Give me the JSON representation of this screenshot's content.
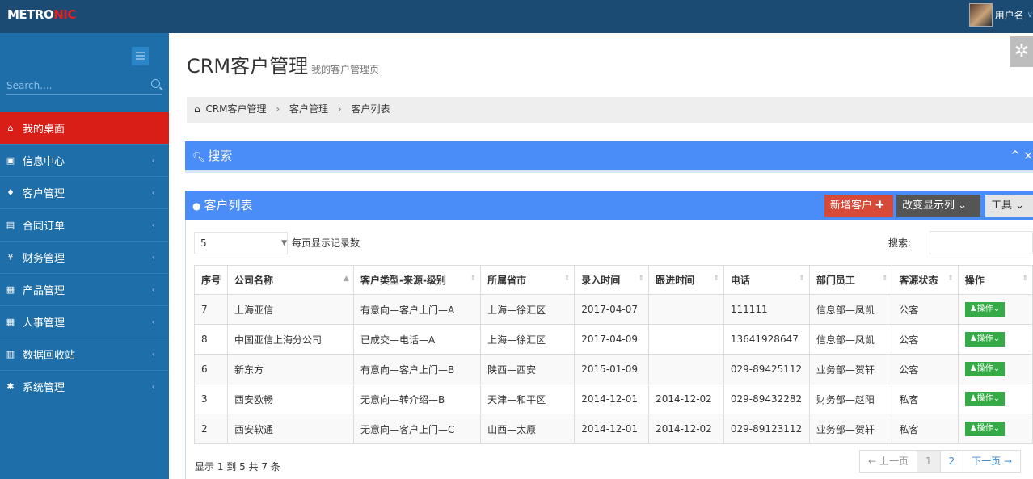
{
  "app": {
    "logo_main": "METRO",
    "logo_accent": "NIC",
    "username": "用户名",
    "accent_color": "#d91e18",
    "brand_color": "#4b8df8"
  },
  "sidebar": {
    "search_placeholder": "Search....",
    "items": [
      {
        "label": "我的桌面",
        "icon": "home-icon",
        "glyph": "⌂"
      },
      {
        "label": "信息中心",
        "icon": "monitor-icon",
        "glyph": "▣"
      },
      {
        "label": "客户管理",
        "icon": "user-icon",
        "glyph": "♦"
      },
      {
        "label": "合同订单",
        "icon": "book-icon",
        "glyph": "▤"
      },
      {
        "label": "财务管理",
        "icon": "yen-icon",
        "glyph": "¥"
      },
      {
        "label": "产品管理",
        "icon": "table-icon",
        "glyph": "▦"
      },
      {
        "label": "人事管理",
        "icon": "table-icon",
        "glyph": "▦"
      },
      {
        "label": "数据回收站",
        "icon": "trash-icon",
        "glyph": "▥"
      },
      {
        "label": "系统管理",
        "icon": "gear-icon",
        "glyph": "✱"
      }
    ]
  },
  "page": {
    "title": "CRM客户管理",
    "subtitle": "我的客户管理页",
    "breadcrumb": [
      "CRM客户管理",
      "客户管理",
      "客户列表"
    ]
  },
  "search_panel": {
    "title": "搜索",
    "tools": "^ ×"
  },
  "list_panel": {
    "title": "客户列表",
    "add_label": "新增客户",
    "cols_label": "改变显示列",
    "tools_label": "工具"
  },
  "table_controls": {
    "page_length": "5",
    "length_label": "每页显示记录数",
    "filter_label": "搜索:"
  },
  "table": {
    "headers": [
      "序号",
      "公司名称",
      "客户类型-来源-级别",
      "所属省市",
      "录入时间",
      "跟进时间",
      "电话",
      "部门员工",
      "客源状态",
      "操作"
    ],
    "rows": [
      [
        "7",
        "上海亚信",
        "有意向—客户上门—A",
        "上海—徐汇区",
        "2017-04-07",
        "",
        "111111",
        "信息部—凤凯",
        "公客",
        "操作"
      ],
      [
        "8",
        "中国亚信上海分公司",
        "已成交—电话—A",
        "上海—徐汇区",
        "2017-04-09",
        "",
        "13641928647",
        "信息部—凤凯",
        "公客",
        "操作"
      ],
      [
        "6",
        "新东方",
        "有意向—客户上门—B",
        "陕西—西安",
        "2015-01-09",
        "",
        "029-89425112",
        "业务部—贺轩",
        "公客",
        "操作"
      ],
      [
        "3",
        "西安欧畅",
        "无意向—转介绍—B",
        "天津—和平区",
        "2014-12-01",
        "2014-12-02",
        "029-89432282",
        "财务部—赵阳",
        "私客",
        "操作"
      ],
      [
        "2",
        "西安软通",
        "无意向—客户上门—C",
        "山西—太原",
        "2014-12-01",
        "2014-12-02",
        "029-89123112",
        "业务部—贺轩",
        "私客",
        "操作"
      ]
    ]
  },
  "footer": {
    "info": "显示 1 到 5 共 7 条",
    "prev": "← 上一页",
    "pages": [
      "1",
      "2"
    ],
    "next": "下一页 →"
  }
}
